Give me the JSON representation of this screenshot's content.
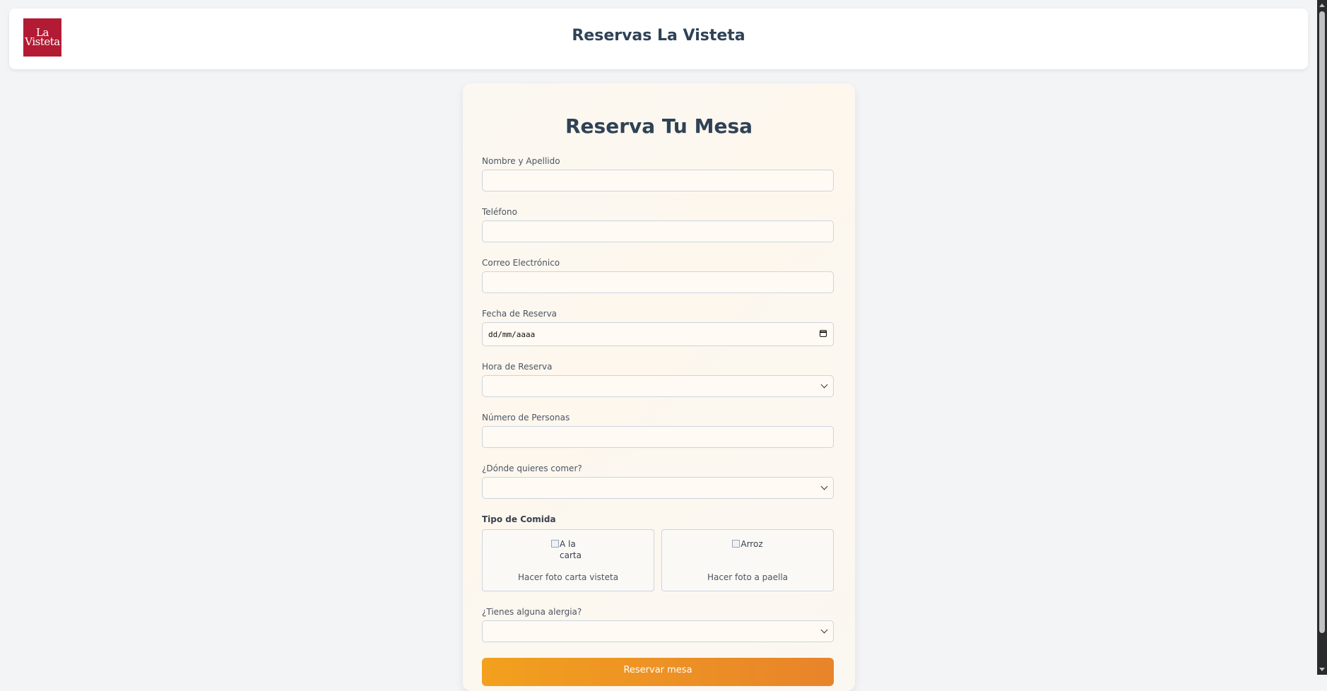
{
  "header": {
    "logo_text": "La Visteta",
    "title": "Reservas La Visteta"
  },
  "form": {
    "title": "Reserva Tu Mesa",
    "fields": {
      "name": {
        "label": "Nombre y Apellido",
        "value": ""
      },
      "phone": {
        "label": "Teléfono",
        "value": ""
      },
      "email": {
        "label": "Correo Electrónico",
        "value": ""
      },
      "date": {
        "label": "Fecha de Reserva",
        "placeholder": "dd/mm/aaaa"
      },
      "time": {
        "label": "Hora de Reserva",
        "selected": ""
      },
      "people": {
        "label": "Número de Personas",
        "value": ""
      },
      "location": {
        "label": "¿Dónde quieres comer?",
        "selected": ""
      },
      "allergy": {
        "label": "¿Tienes alguna alergia?",
        "selected": ""
      }
    },
    "food_type": {
      "label": "Tipo de Comida",
      "options": [
        {
          "alt": "A la carta",
          "text": "Hacer foto carta visteta"
        },
        {
          "alt": "Arroz",
          "text": "Hacer foto a paella"
        }
      ]
    },
    "submit_label": "Reservar mesa"
  },
  "colors": {
    "background": "#f3f4f6",
    "logo": "#b31b34",
    "title": "#2f4256",
    "button_start": "#f2a01e",
    "button_end": "#e8842a"
  }
}
